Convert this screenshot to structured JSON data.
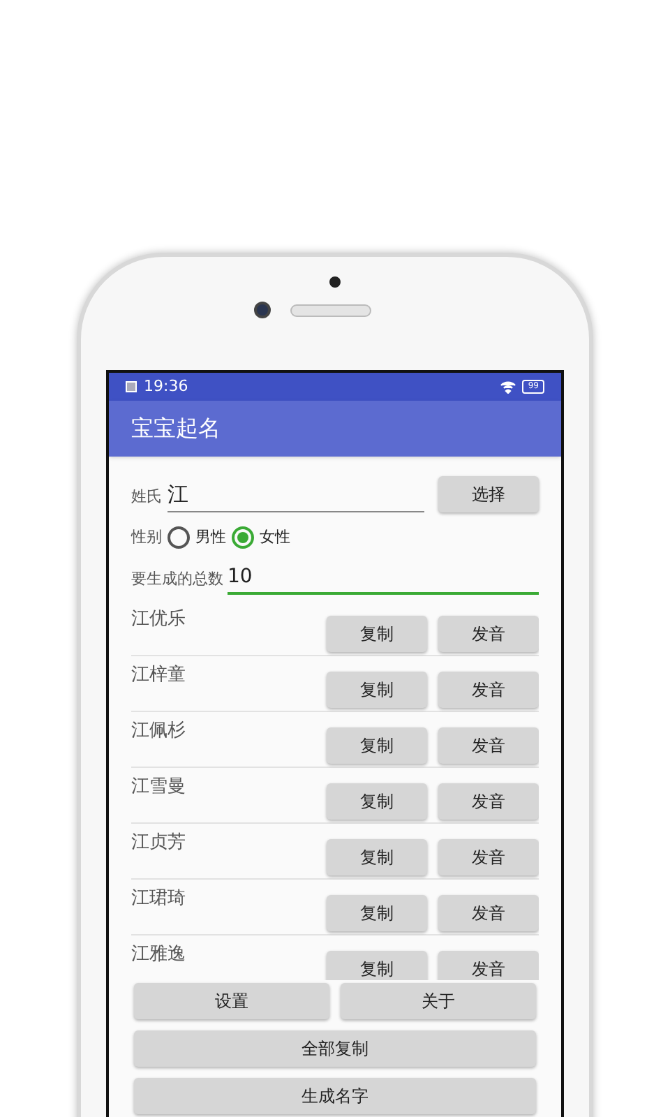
{
  "status_bar": {
    "time": "19:36",
    "battery": "99"
  },
  "app_bar": {
    "title": "宝宝起名"
  },
  "surname": {
    "label": "姓氏",
    "value": "江",
    "button": "选择"
  },
  "gender": {
    "label": "性别",
    "options": [
      {
        "label": "男性",
        "selected": false
      },
      {
        "label": "女性",
        "selected": true
      }
    ]
  },
  "count": {
    "label": "要生成的总数",
    "value": "10"
  },
  "names": [
    {
      "name": "江优乐",
      "copy": "复制",
      "speak": "发音"
    },
    {
      "name": "江梓童",
      "copy": "复制",
      "speak": "发音"
    },
    {
      "name": "江佩杉",
      "copy": "复制",
      "speak": "发音"
    },
    {
      "name": "江雪曼",
      "copy": "复制",
      "speak": "发音"
    },
    {
      "name": "江贞芳",
      "copy": "复制",
      "speak": "发音"
    },
    {
      "name": "江珺琦",
      "copy": "复制",
      "speak": "发音"
    },
    {
      "name": "江雅逸",
      "copy": "复制",
      "speak": "发音"
    }
  ],
  "bottom_buttons": [
    [
      "设置",
      "关于"
    ],
    [
      "全部复制"
    ],
    [
      "生成名字"
    ]
  ]
}
